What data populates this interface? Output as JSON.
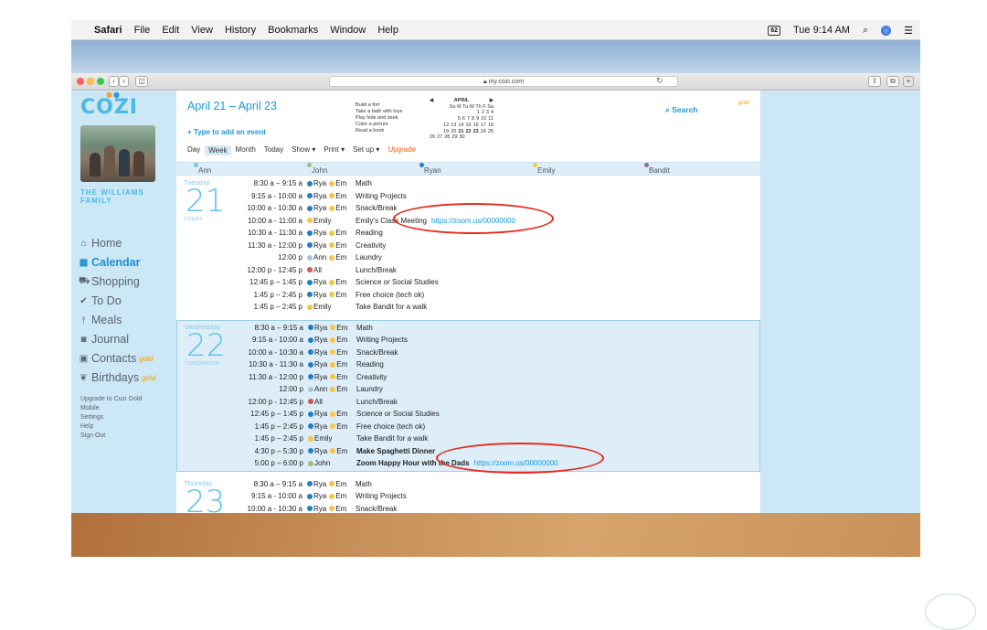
{
  "menubar": {
    "apple": "",
    "items": [
      "Safari",
      "File",
      "Edit",
      "View",
      "History",
      "Bookmarks",
      "Window",
      "Help"
    ],
    "battery": "62",
    "clock": "Tue 9:14 AM"
  },
  "browser": {
    "url": "my.cozi.com"
  },
  "sidebar": {
    "logo": "COZI",
    "family_name": "THE WILLIAMS FAMILY",
    "nav": [
      {
        "icon": "home-icon",
        "glyph": "⌂",
        "label": "Home",
        "gold": ""
      },
      {
        "icon": "calendar-icon",
        "glyph": "▦",
        "label": "Calendar",
        "gold": ""
      },
      {
        "icon": "cart-icon",
        "glyph": "⛟",
        "label": "Shopping",
        "gold": ""
      },
      {
        "icon": "check-icon",
        "glyph": "✔",
        "label": "To Do",
        "gold": ""
      },
      {
        "icon": "fork-knife-icon",
        "glyph": "⫯",
        "label": "Meals",
        "gold": ""
      },
      {
        "icon": "camera-icon",
        "glyph": "◙",
        "label": "Journal",
        "gold": ""
      },
      {
        "icon": "contact-card-icon",
        "glyph": "▣",
        "label": "Contacts",
        "gold": "gold"
      },
      {
        "icon": "gift-icon",
        "glyph": "❦",
        "label": "Birthdays",
        "gold": "gold"
      }
    ],
    "links": [
      "Upgrade to Cozi Gold",
      "Mobile",
      "Settings",
      "Help",
      "Sign Out"
    ]
  },
  "header": {
    "date_range": "April 21 – April 23",
    "add_event": "+ Type to add an event",
    "tabs": [
      "Day",
      "Week",
      "Month",
      "Today",
      "Show ▾",
      "Print ▾",
      "Set up ▾",
      "Upgrade"
    ],
    "todos": [
      "Build a fort",
      "Take a bath with toys",
      "Play hide and seek",
      "Color a picture",
      "Read a book"
    ],
    "search_label": "Search",
    "search_gold": "gold"
  },
  "minical": {
    "month": "APRIL",
    "prev": "◀",
    "next": "▶",
    "days_header": "Su M Tu W Th F Sa",
    "rows": [
      "1 2 3 4",
      "5 6 7 8 9 10 11",
      "12 13 14 15 16 17 18",
      "19 20 21 22 23 24 25",
      "26 27 28 29 30"
    ]
  },
  "people": [
    {
      "name": "Ann",
      "color": "#7fc8e6"
    },
    {
      "name": "John",
      "color": "#9bc47a"
    },
    {
      "name": "Ryan",
      "color": "#1e7fc7"
    },
    {
      "name": "Emily",
      "color": "#f7c545"
    },
    {
      "name": "Bandit",
      "color": "#8e6aa8"
    }
  ],
  "days": [
    {
      "name": "Tuesday",
      "num": "21",
      "tag": "TODAY",
      "highlight": false,
      "events": [
        {
          "time": "8:30 a – 9:15 a",
          "who": [
            [
              "blue",
              "Rya"
            ],
            [
              "yellow",
              "Em"
            ]
          ],
          "desc": "Math",
          "link": "",
          "bold": false
        },
        {
          "time": "9:15 a - 10:00 a",
          "who": [
            [
              "blue",
              "Rya"
            ],
            [
              "yellow",
              "Em"
            ]
          ],
          "desc": "Writing Projects",
          "link": "",
          "bold": false
        },
        {
          "time": "10:00 a - 10:30 a",
          "who": [
            [
              "blue",
              "Rya"
            ],
            [
              "yellow",
              "Em"
            ]
          ],
          "desc": "Snack/Break",
          "link": "",
          "bold": false
        },
        {
          "time": "10:00 a - 11:00 a",
          "who": [
            [
              "yellow",
              "Emily"
            ]
          ],
          "desc": "Emily's Class Meeting",
          "link": "https://zoom.us/00000000",
          "bold": false
        },
        {
          "time": "10:30 a - 11:30 a",
          "who": [
            [
              "blue",
              "Rya"
            ],
            [
              "yellow",
              "Em"
            ]
          ],
          "desc": "Reading",
          "link": "",
          "bold": false
        },
        {
          "time": "11:30 a - 12:00 p",
          "who": [
            [
              "blue",
              "Rya"
            ],
            [
              "yellow",
              "Em"
            ]
          ],
          "desc": "Creativity",
          "link": "",
          "bold": false
        },
        {
          "time": "12:00 p",
          "who": [
            [
              "grey",
              "Ann"
            ],
            [
              "yellow",
              "Em"
            ]
          ],
          "desc": "Laundry",
          "link": "",
          "bold": false
        },
        {
          "time": "12:00 p - 12:45 p",
          "who": [
            [
              "red",
              "All"
            ]
          ],
          "desc": "Lunch/Break",
          "link": "",
          "bold": false
        },
        {
          "time": "12:45 p – 1:45 p",
          "who": [
            [
              "blue",
              "Rya"
            ],
            [
              "yellow",
              "Em"
            ]
          ],
          "desc": "Science or Social Studies",
          "link": "",
          "bold": false
        },
        {
          "time": "1:45 p – 2:45 p",
          "who": [
            [
              "blue",
              "Rya"
            ],
            [
              "yellow",
              "Em"
            ]
          ],
          "desc": "Free choice (tech ok)",
          "link": "",
          "bold": false
        },
        {
          "time": "1:45 p – 2:45 p",
          "who": [
            [
              "yellow",
              "Emily"
            ]
          ],
          "desc": "Take Bandit for a walk",
          "link": "",
          "bold": false
        }
      ]
    },
    {
      "name": "Wednesday",
      "num": "22",
      "tag": "TOMORROW",
      "highlight": true,
      "events": [
        {
          "time": "8:30 a – 9:15 a",
          "who": [
            [
              "blue",
              "Rya"
            ],
            [
              "yellow",
              "Em"
            ]
          ],
          "desc": "Math",
          "link": "",
          "bold": false
        },
        {
          "time": "9:15 a - 10:00 a",
          "who": [
            [
              "blue",
              "Rya"
            ],
            [
              "yellow",
              "Em"
            ]
          ],
          "desc": "Writing Projects",
          "link": "",
          "bold": false
        },
        {
          "time": "10:00 a - 10:30 a",
          "who": [
            [
              "blue",
              "Rya"
            ],
            [
              "yellow",
              "Em"
            ]
          ],
          "desc": "Snack/Break",
          "link": "",
          "bold": false
        },
        {
          "time": "10:30 a - 11:30 a",
          "who": [
            [
              "blue",
              "Rya"
            ],
            [
              "yellow",
              "Em"
            ]
          ],
          "desc": "Reading",
          "link": "",
          "bold": false
        },
        {
          "time": "11:30 a - 12:00 p",
          "who": [
            [
              "blue",
              "Rya"
            ],
            [
              "yellow",
              "Em"
            ]
          ],
          "desc": "Creativity",
          "link": "",
          "bold": false
        },
        {
          "time": "12:00 p",
          "who": [
            [
              "grey",
              "Ann"
            ],
            [
              "yellow",
              "Em"
            ]
          ],
          "desc": "Laundry",
          "link": "",
          "bold": false
        },
        {
          "time": "12:00 p - 12:45 p",
          "who": [
            [
              "red",
              "All"
            ]
          ],
          "desc": "Lunch/Break",
          "link": "",
          "bold": false
        },
        {
          "time": "12:45 p – 1:45 p",
          "who": [
            [
              "blue",
              "Rya"
            ],
            [
              "yellow",
              "Em"
            ]
          ],
          "desc": "Science or Social Studies",
          "link": "",
          "bold": false
        },
        {
          "time": "1:45 p – 2:45 p",
          "who": [
            [
              "blue",
              "Rya"
            ],
            [
              "yellow",
              "Em"
            ]
          ],
          "desc": "Free choice (tech ok)",
          "link": "",
          "bold": false
        },
        {
          "time": "1:45 p – 2:45 p",
          "who": [
            [
              "yellow",
              "Emily"
            ]
          ],
          "desc": "Take Bandit for a walk",
          "link": "",
          "bold": false
        },
        {
          "time": "4:30 p – 5:30 p",
          "who": [
            [
              "blue",
              "Rya"
            ],
            [
              "yellow",
              "Em"
            ]
          ],
          "desc": "Make Spaghetti Dinner",
          "link": "",
          "bold": true
        },
        {
          "time": "5:00 p – 6:00 p",
          "who": [
            [
              "green",
              "John"
            ]
          ],
          "desc": "Zoom Happy Hour with the Dads",
          "link": "https://zoom.us/00000000",
          "bold": true
        }
      ]
    },
    {
      "name": "Thursday",
      "num": "23",
      "tag": "",
      "highlight": false,
      "events": [
        {
          "time": "8:30 a – 9:15 a",
          "who": [
            [
              "blue",
              "Rya"
            ],
            [
              "yellow",
              "Em"
            ]
          ],
          "desc": "Math",
          "link": "",
          "bold": false
        },
        {
          "time": "9:15 a - 10:00 a",
          "who": [
            [
              "blue",
              "Rya"
            ],
            [
              "yellow",
              "Em"
            ]
          ],
          "desc": "Writing Projects",
          "link": "",
          "bold": false
        },
        {
          "time": "10:00 a - 10:30 a",
          "who": [
            [
              "blue",
              "Rya"
            ],
            [
              "yellow",
              "Em"
            ]
          ],
          "desc": "Snack/Break",
          "link": "",
          "bold": false
        }
      ]
    }
  ],
  "colors": {
    "accent": "#1a9ad6",
    "annotation": "#e8291c",
    "gold": "#f0a400"
  }
}
